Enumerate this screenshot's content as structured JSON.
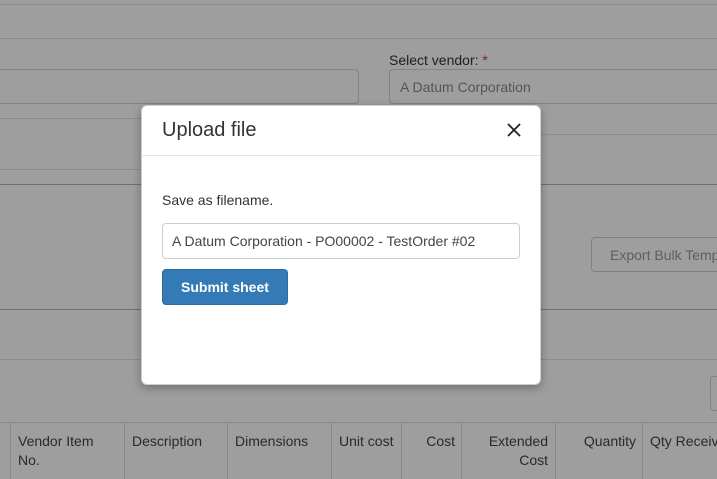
{
  "background": {
    "vendor_label": "Select vendor:",
    "required_marker": "*",
    "vendor_value": "A Datum Corporation",
    "export_button_label": "Export Bulk Temp",
    "table_columns": [
      "Vendor Item No.",
      "Description",
      "Dimensions",
      "Unit cost",
      "Cost",
      "Extended Cost",
      "Quantity",
      "Qty Receiv"
    ]
  },
  "modal": {
    "title": "Upload file",
    "close_symbol": "×",
    "help_text": "Save as filename.",
    "filename_value": "A Datum Corporation - PO00002 - TestOrder #02",
    "submit_label": "Submit sheet"
  }
}
